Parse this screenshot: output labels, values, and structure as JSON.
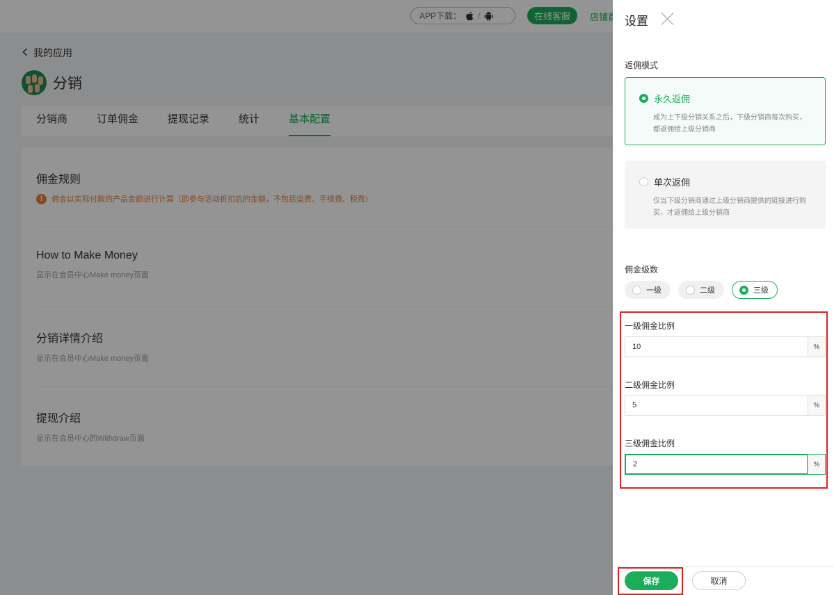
{
  "topbar": {
    "app_download_label": "APP下载：",
    "separator": "/",
    "apple_icon": "apple-icon",
    "android_icon": "android-icon",
    "service_button": "在线客服",
    "shop_home_link": "店铺首"
  },
  "page": {
    "back_label": "我的应用",
    "app_title": "分销",
    "tabs": [
      {
        "label": "分销商"
      },
      {
        "label": "订单佣金"
      },
      {
        "label": "提现记录"
      },
      {
        "label": "统计"
      },
      {
        "label": "基本配置"
      }
    ],
    "active_tab": "基本配置",
    "sections": [
      {
        "title": "佣金规则",
        "note": "佣金以实际付款的产品金额进行计算（即参与活动折扣后的金额，不包括运费、手续费、税费）"
      },
      {
        "title": "How to Make Money",
        "desc": "显示在会员中心Make money页面"
      },
      {
        "title": "分销详情介绍",
        "desc": "显示在会员中心Make money页面"
      },
      {
        "title": "提现介绍",
        "desc": "显示在会员中心的Withdraw页面"
      }
    ]
  },
  "drawer": {
    "title": "设置",
    "rebate_mode_label": "返佣模式",
    "modes": [
      {
        "name": "永久返佣",
        "desc": "成为上下级分销关系之后，下级分销商每次购买，都返佣给上级分销商",
        "selected": true
      },
      {
        "name": "单次返佣",
        "desc": "仅当下级分销商通过上级分销商提供的链接进行购买，才返佣给上级分销商",
        "selected": false
      }
    ],
    "levels_label": "佣金级数",
    "levels": [
      {
        "label": "一级",
        "selected": false
      },
      {
        "label": "二级",
        "selected": false
      },
      {
        "label": "三级",
        "selected": true
      }
    ],
    "fields": [
      {
        "label": "一级佣金比例",
        "value": "10",
        "unit": "%"
      },
      {
        "label": "二级佣金比例",
        "value": "5",
        "unit": "%"
      },
      {
        "label": "三级佣金比例",
        "value": "2",
        "unit": "%"
      }
    ],
    "save_button": "保存",
    "cancel_button": "取消"
  },
  "colors": {
    "accent": "#1aad5a",
    "warning": "#e5803c",
    "highlight_box": "#e02020",
    "overlay": "rgba(0,0,0,0.42)"
  }
}
